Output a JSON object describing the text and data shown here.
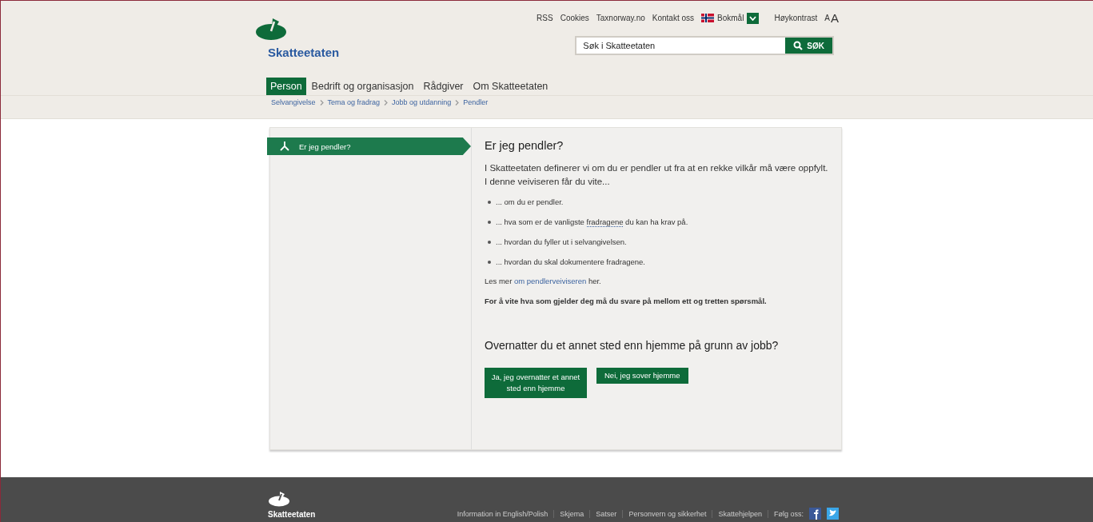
{
  "header": {
    "logo_text": "Skatteetaten",
    "top_links": [
      "RSS",
      "Cookies",
      "Taxnorway.no",
      "Kontakt oss"
    ],
    "language": "Bokmål",
    "contrast": "Høykontrast",
    "font_sizes": [
      "A",
      "A"
    ],
    "search": {
      "placeholder": "Søk i Skatteetaten",
      "button": "SØK"
    },
    "nav": [
      {
        "label": "Person",
        "selected": true
      },
      {
        "label": "Bedrift og organisasjon",
        "selected": false
      },
      {
        "label": "Rådgiver",
        "selected": false
      },
      {
        "label": "Om Skatteetaten",
        "selected": false
      }
    ],
    "breadcrumb": [
      "Selvangivelse",
      "Tema og fradrag",
      "Jobb og utdanning",
      "Pendler"
    ]
  },
  "steps": [
    {
      "label": "Er jeg pendler?",
      "selected": true
    }
  ],
  "content": {
    "title": "Er jeg pendler?",
    "intro": "I Skatteetaten definerer vi om du er pendler ut fra at en rekke vilkår må være oppfylt. I denne veiviseren får du vite...",
    "bullets": [
      {
        "text": "... om du er pendler."
      },
      {
        "text": "... hva som er de vanligste",
        "term": "fradragene",
        "after": "du kan ha krav på."
      },
      {
        "text": "... hvordan du fyller ut i selvangivelsen."
      },
      {
        "text": "... hvordan du skal dokumentere fradragene."
      }
    ],
    "read_more": {
      "before": "Les mer",
      "link": "om pendlerveiviseren",
      "after": "her."
    },
    "note": "For å vite hva som gjelder deg må du svare på mellom ett og tretten spørsmål.",
    "question": "Overnatter du et annet sted enn hjemme på grunn av jobb?",
    "answers": [
      "Ja, jeg overnatter et annet sted enn hjemme",
      "Nei, jeg sover hjemme"
    ]
  },
  "footer": {
    "logo_text": "Skatteetaten",
    "links": [
      "Information in English/Polish",
      "Skjema",
      "Satser",
      "Personvern og sikkerhet",
      "Skattehjelpen"
    ],
    "follow": "Følg oss:"
  }
}
